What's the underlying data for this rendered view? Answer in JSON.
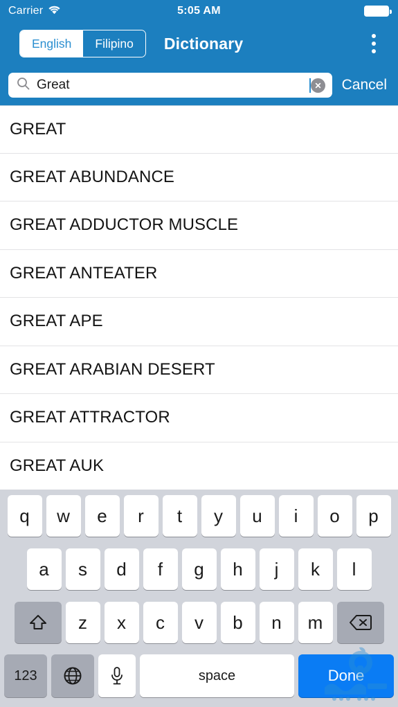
{
  "status_bar": {
    "carrier": "Carrier",
    "wifi_icon": "wifi-icon",
    "time": "5:05 AM",
    "battery_icon": "battery-full-icon"
  },
  "nav_bar": {
    "title": "Dictionary",
    "segments": [
      {
        "label": "English",
        "selected": true
      },
      {
        "label": "Filipino",
        "selected": false
      }
    ],
    "overflow_icon": "kebab-menu-icon"
  },
  "search": {
    "icon": "search-icon",
    "value": "Great",
    "placeholder": "Search",
    "clear_icon": "clear-circle-icon",
    "cancel_label": "Cancel"
  },
  "results": [
    {
      "term": "GREAT"
    },
    {
      "term": "GREAT ABUNDANCE"
    },
    {
      "term": "GREAT ADDUCTOR MUSCLE"
    },
    {
      "term": "GREAT ANTEATER"
    },
    {
      "term": "GREAT APE"
    },
    {
      "term": "GREAT ARABIAN DESERT"
    },
    {
      "term": "GREAT ATTRACTOR"
    },
    {
      "term": "GREAT AUK"
    }
  ],
  "keyboard": {
    "row1": [
      "q",
      "w",
      "e",
      "r",
      "t",
      "y",
      "u",
      "i",
      "o",
      "p"
    ],
    "row2": [
      "a",
      "s",
      "d",
      "f",
      "g",
      "h",
      "j",
      "k",
      "l"
    ],
    "row3": [
      "z",
      "x",
      "c",
      "v",
      "b",
      "n",
      "m"
    ],
    "shift_icon": "shift-arrow-icon",
    "backspace_icon": "backspace-icon",
    "numbers_label": "123",
    "globe_icon": "globe-icon",
    "mic_icon": "microphone-icon",
    "space_label": "space",
    "done_label": "Done"
  },
  "colors": {
    "nav_blue": "#1c7fbf",
    "done_blue": "#0a7cf4",
    "keyboard_bg": "#d1d4db",
    "key_white": "#ffffff",
    "key_gray": "#a6aab4",
    "separator": "#e3e3e5"
  }
}
